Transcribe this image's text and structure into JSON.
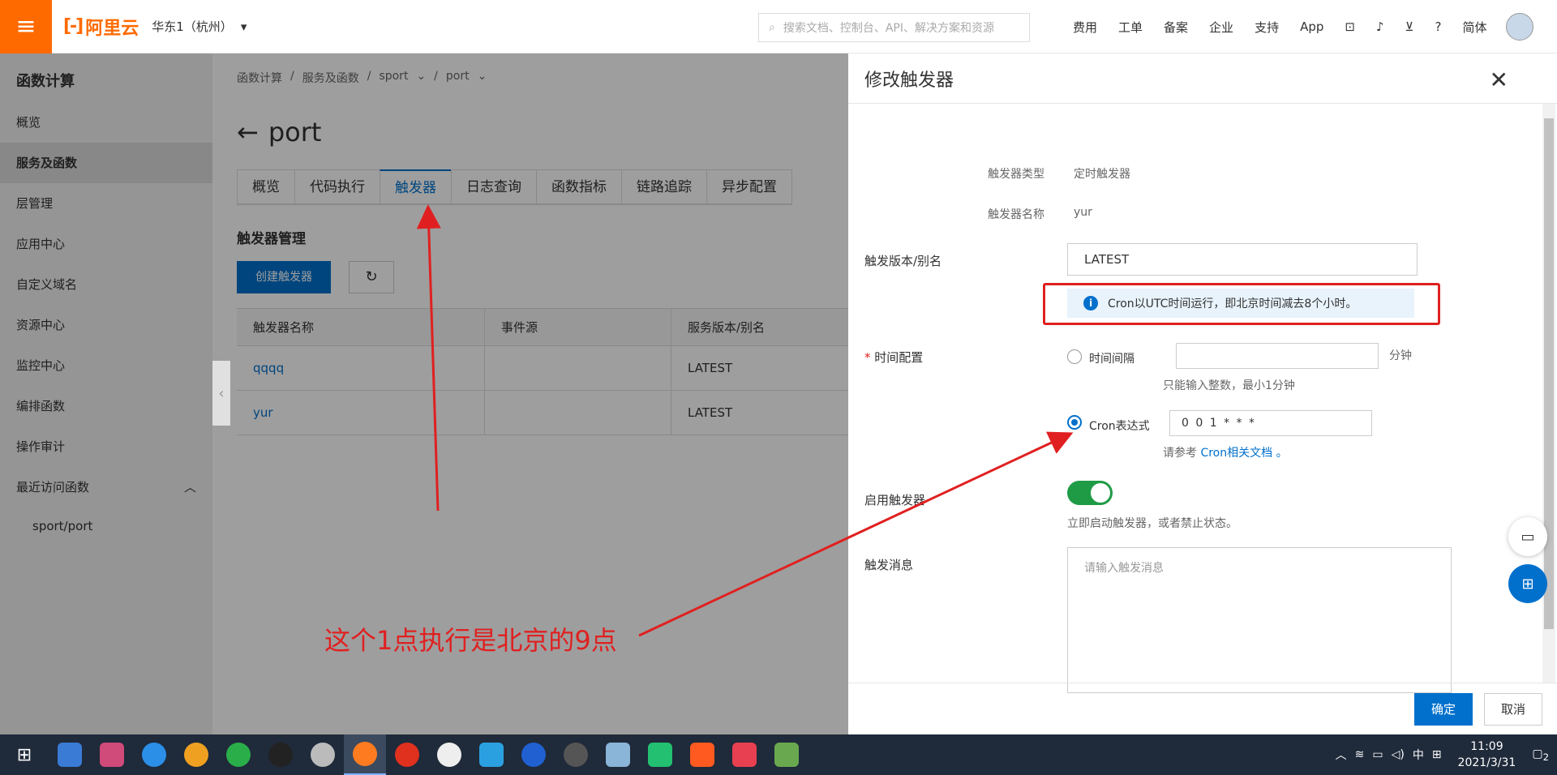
{
  "topbar": {
    "brand": "阿里云",
    "region": "华东1（杭州）",
    "search_placeholder": "搜索文档、控制台、API、解决方案和资源",
    "nav": [
      "费用",
      "工单",
      "备案",
      "企业",
      "支持",
      "App"
    ],
    "lang": "简体"
  },
  "sidebar": {
    "title": "函数计算",
    "items": [
      "概览",
      "服务及函数",
      "层管理",
      "应用中心",
      "自定义域名",
      "资源中心",
      "监控中心",
      "编排函数",
      "操作审计",
      "最近访问函数"
    ],
    "recent": "sport/port"
  },
  "main": {
    "breadcrumb": [
      "函数计算",
      "服务及函数",
      "sport",
      "port"
    ],
    "title": "port",
    "tabs": [
      "概览",
      "代码执行",
      "触发器",
      "日志查询",
      "函数指标",
      "链路追踪",
      "异步配置"
    ],
    "section_title": "触发器管理",
    "create_button": "创建触发器",
    "table": {
      "headers": [
        "触发器名称",
        "事件源",
        "服务版本/别名"
      ],
      "rows": [
        [
          "qqqq",
          "",
          "LATEST"
        ],
        [
          "yur",
          "",
          "LATEST"
        ]
      ]
    }
  },
  "panel": {
    "title": "修改触发器",
    "trigger_type_label": "触发器类型",
    "trigger_type_value": "定时触发器",
    "trigger_name_label": "触发器名称",
    "trigger_name_value": "yur",
    "version_label": "触发版本/别名",
    "version_value": "LATEST",
    "notice": "Cron以UTC时间运行，即北京时间减去8个小时。",
    "time_config_label": "时间配置",
    "required_mark": "*",
    "interval_label": "时间间隔",
    "interval_unit": "分钟",
    "interval_hint": "只能输入整数，最小1分钟",
    "cron_label": "Cron表达式",
    "cron_value": "0 0 1 * * *",
    "cron_hint_prefix": "请参考",
    "cron_hint_link": "Cron相关文档",
    "cron_hint_suffix": "。",
    "enable_label": "启用触发器",
    "enable_hint": "立即启动触发器，或者禁止状态。",
    "message_label": "触发消息",
    "message_placeholder": "请输入触发消息",
    "ok_button": "确定",
    "cancel_button": "取消"
  },
  "annotation": "这个1点执行是北京的9点",
  "taskbar": {
    "time": "11:09",
    "date": "2021/3/31",
    "ime": "中",
    "notifications": "2"
  },
  "colors": {
    "brand": "#ff6a00",
    "primary": "#0070cc",
    "annotation_red": "#e02020",
    "toggle_on": "#1f9b46"
  }
}
